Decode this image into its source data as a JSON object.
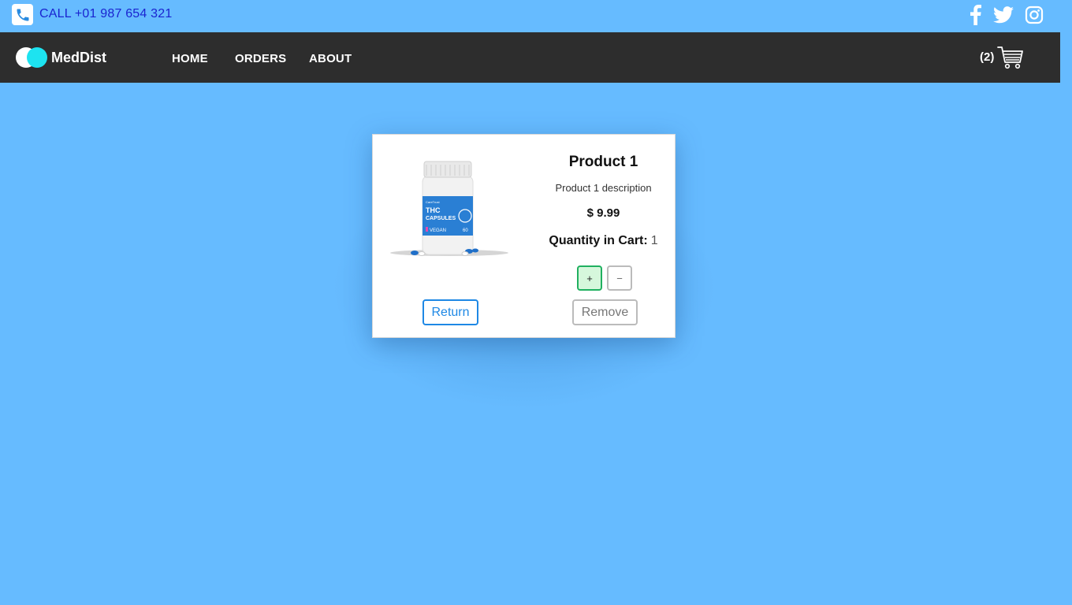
{
  "topbar": {
    "call_text": "CALL +01 987 654 321",
    "phone_icon": "phone-icon",
    "social_icons": [
      "facebook-icon",
      "twitter-icon",
      "instagram-icon"
    ]
  },
  "navbar": {
    "brand": "MedDist",
    "links": [
      "HOME",
      "ORDERS",
      "ABOUT"
    ],
    "cart_count": "(2)",
    "cart_icon": "cart-icon"
  },
  "product": {
    "title": "Product 1",
    "description": "Product 1 description",
    "price": "$ 9.99",
    "quantity_label": "Quantity in Cart:",
    "quantity_value": "1",
    "image_text": {
      "brand": "CareTrust",
      "line1": "THC",
      "line2": "CAPSULES",
      "vegan": "VEGAN",
      "count": "60"
    },
    "plus_label": "+",
    "minus_label": "−",
    "return_label": "Return",
    "remove_label": "Remove"
  },
  "colors": {
    "background": "#66bbff",
    "navbar": "#2d2d2d",
    "call_text": "#1a24d0",
    "logo_accent": "#1de3f0",
    "return_border": "#1e88e5",
    "plus_border": "#20b060",
    "plus_fill": "#d6f7dc"
  }
}
